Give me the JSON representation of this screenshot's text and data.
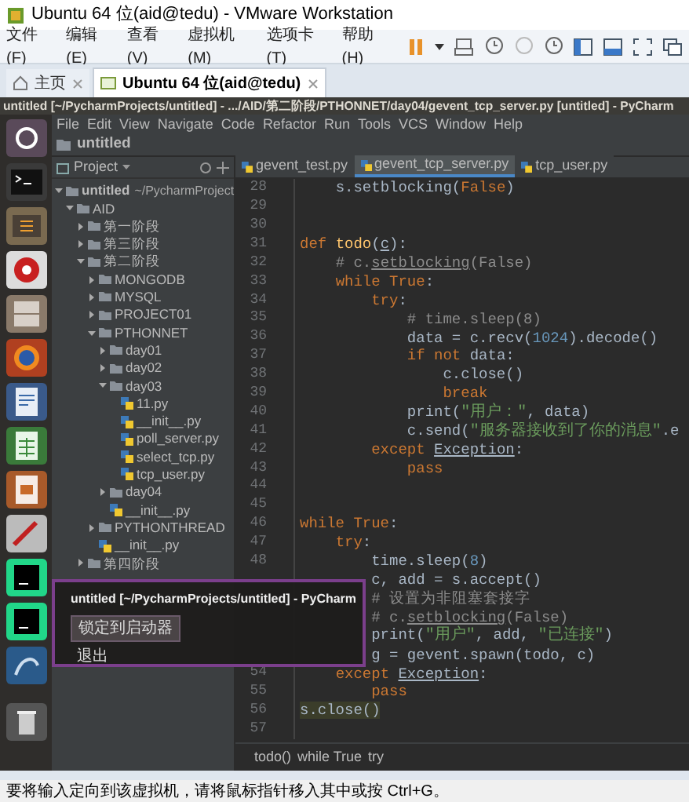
{
  "window": {
    "title": "Ubuntu 64 位(aid@tedu) - VMware Workstation"
  },
  "menu": [
    "文件(F)",
    "编辑(E)",
    "查看(V)",
    "虚拟机(M)",
    "选项卡(T)",
    "帮助(H)"
  ],
  "vm_tabs": [
    {
      "label": "主页",
      "selected": false,
      "kind": "home"
    },
    {
      "label": "Ubuntu 64 位(aid@tedu)",
      "selected": true,
      "kind": "vm"
    }
  ],
  "ubuntu_top_bar": {
    "title": "untitled [~/PycharmProjects/untitled] - .../AID/第二阶段/PTHONNET/day04/gevent_tcp_server.py [untitled] - PyCharm"
  },
  "pycharm": {
    "menu": [
      "File",
      "Edit",
      "View",
      "Navigate",
      "Code",
      "Refactor",
      "Run",
      "Tools",
      "VCS",
      "Window",
      "Help"
    ],
    "nav_bar": "untitled",
    "project_header": "Project",
    "tree": [
      {
        "label": "untitled",
        "hint": "~/PycharmProject",
        "kind": "folder",
        "expanded": true,
        "children": [
          {
            "label": "AID",
            "kind": "folder",
            "expanded": true,
            "children": [
              {
                "label": "第一阶段",
                "kind": "folder",
                "expanded": false
              },
              {
                "label": "第三阶段",
                "kind": "folder",
                "expanded": false
              },
              {
                "label": "第二阶段",
                "kind": "folder",
                "expanded": true,
                "children": [
                  {
                    "label": "MONGODB",
                    "kind": "folder",
                    "expanded": false
                  },
                  {
                    "label": "MYSQL",
                    "kind": "folder",
                    "expanded": false
                  },
                  {
                    "label": "PROJECT01",
                    "kind": "folder",
                    "expanded": false
                  },
                  {
                    "label": "PTHONNET",
                    "kind": "folder",
                    "expanded": true,
                    "children": [
                      {
                        "label": "day01",
                        "kind": "folder",
                        "expanded": false
                      },
                      {
                        "label": "day02",
                        "kind": "folder",
                        "expanded": false
                      },
                      {
                        "label": "day03",
                        "kind": "folder",
                        "expanded": true,
                        "children": [
                          {
                            "label": "11.py",
                            "kind": "file"
                          },
                          {
                            "label": "__init__.py",
                            "kind": "file"
                          },
                          {
                            "label": "poll_server.py",
                            "kind": "file"
                          },
                          {
                            "label": "select_tcp.py",
                            "kind": "file"
                          },
                          {
                            "label": "tcp_user.py",
                            "kind": "file"
                          }
                        ]
                      },
                      {
                        "label": "day04",
                        "kind": "folder",
                        "expanded": false
                      },
                      {
                        "label": "__init__.py",
                        "kind": "file"
                      }
                    ]
                  },
                  {
                    "label": "PYTHONTHREAD",
                    "kind": "folder",
                    "expanded": false
                  },
                  {
                    "label": "__init__.py",
                    "kind": "file"
                  }
                ]
              },
              {
                "label": "第四阶段",
                "kind": "folder",
                "expanded": false
              }
            ]
          }
        ]
      }
    ],
    "editor_tabs": [
      {
        "label": "gevent_test.py",
        "selected": false
      },
      {
        "label": "gevent_tcp_server.py",
        "selected": true
      },
      {
        "label": "tcp_user.py",
        "selected": false
      }
    ],
    "code": [
      {
        "n": "28",
        "segs": [
          {
            "text": "    s.setblocking(",
            "kind": "plain"
          },
          {
            "text": "False",
            "kind": "keyword"
          },
          {
            "text": ")",
            "kind": "plain"
          }
        ]
      },
      {
        "n": "29"
      },
      {
        "n": "30"
      },
      {
        "n": "31",
        "segs": [
          {
            "text": "def ",
            "kind": "keyword"
          },
          {
            "text": "todo",
            "kind": "function"
          },
          {
            "text": "(",
            "kind": "plain"
          },
          {
            "text": "c",
            "kind": "underlined"
          },
          {
            "text": "):",
            "kind": "plain"
          }
        ]
      },
      {
        "n": "32",
        "segs": [
          {
            "text": "    # c.",
            "kind": "comment"
          },
          {
            "text": "setblocking",
            "kind": "spellcheck"
          },
          {
            "text": "(False)",
            "kind": "comment"
          }
        ]
      },
      {
        "n": "33",
        "segs": [
          {
            "text": "    while True",
            "kind": "keyword"
          },
          {
            "text": ":",
            "kind": "plain"
          }
        ]
      },
      {
        "n": "34",
        "segs": [
          {
            "text": "        try",
            "kind": "keyword"
          },
          {
            "text": ":",
            "kind": "plain"
          }
        ]
      },
      {
        "n": "35",
        "segs": [
          {
            "text": "            # time.sleep(8)",
            "kind": "comment"
          }
        ]
      },
      {
        "n": "36",
        "segs": [
          {
            "text": "            data = c.recv(",
            "kind": "plain"
          },
          {
            "text": "1024",
            "kind": "number"
          },
          {
            "text": ").decode()",
            "kind": "plain"
          }
        ]
      },
      {
        "n": "37",
        "segs": [
          {
            "text": "            if not ",
            "kind": "keyword"
          },
          {
            "text": "data:",
            "kind": "plain"
          }
        ]
      },
      {
        "n": "38",
        "segs": [
          {
            "text": "                c.close()",
            "kind": "plain"
          }
        ]
      },
      {
        "n": "39",
        "segs": [
          {
            "text": "                break",
            "kind": "keyword"
          }
        ]
      },
      {
        "n": "40",
        "segs": [
          {
            "text": "            print(",
            "kind": "plain"
          },
          {
            "text": "\"用户：\"",
            "kind": "string"
          },
          {
            "text": ", data)",
            "kind": "plain"
          }
        ]
      },
      {
        "n": "41",
        "segs": [
          {
            "text": "            c.send(",
            "kind": "plain"
          },
          {
            "text": "\"服务器接收到了你的消息\"",
            "kind": "string"
          },
          {
            "text": ".e",
            "kind": "plain"
          }
        ]
      },
      {
        "n": "42",
        "segs": [
          {
            "text": "        except ",
            "kind": "keyword"
          },
          {
            "text": "Exception",
            "kind": "underlined"
          },
          {
            "text": ":",
            "kind": "plain"
          }
        ]
      },
      {
        "n": "43",
        "segs": [
          {
            "text": "            pass",
            "kind": "keyword"
          }
        ]
      },
      {
        "n": "44"
      },
      {
        "n": "45"
      },
      {
        "n": "46",
        "segs": [
          {
            "text": "while True",
            "kind": "keyword"
          },
          {
            "text": ":",
            "kind": "plain"
          }
        ]
      },
      {
        "n": "47",
        "segs": [
          {
            "text": "    try",
            "kind": "keyword"
          },
          {
            "text": ":",
            "kind": "plain"
          }
        ]
      },
      {
        "n": "48",
        "segs": [
          {
            "text": "        time.sleep(",
            "kind": "plain"
          },
          {
            "text": "8",
            "kind": "number"
          },
          {
            "text": ")",
            "kind": "plain"
          }
        ]
      },
      {
        "segs": [
          {
            "text": "        c, add = s.accept()",
            "kind": "plain"
          }
        ]
      },
      {
        "segs": [
          {
            "text": "        # 设置为非阻塞套接字",
            "kind": "comment"
          }
        ]
      },
      {
        "segs": [
          {
            "text": "        # c.",
            "kind": "comment"
          },
          {
            "text": "setblocking",
            "kind": "spellcheck"
          },
          {
            "text": "(False)",
            "kind": "comment"
          }
        ]
      },
      {
        "segs": [
          {
            "text": "        print(",
            "kind": "plain"
          },
          {
            "text": "\"用户\"",
            "kind": "string"
          },
          {
            "text": ", add, ",
            "kind": "plain"
          },
          {
            "text": "\"已连接\"",
            "kind": "string"
          },
          {
            "text": ")",
            "kind": "plain"
          }
        ]
      },
      {
        "segs": [
          {
            "text": "        g = gevent.spawn(todo, c)",
            "kind": "plain"
          }
        ]
      },
      {
        "n": "54",
        "segs": [
          {
            "text": "    except ",
            "kind": "keyword"
          },
          {
            "text": "Exception",
            "kind": "underlined"
          },
          {
            "text": ":",
            "kind": "plain"
          }
        ]
      },
      {
        "n": "55",
        "segs": [
          {
            "text": "        pass",
            "kind": "keyword"
          }
        ]
      },
      {
        "n": "56",
        "segs": [
          {
            "text": "s.close()",
            "kind": "highlight"
          }
        ]
      },
      {
        "n": "57"
      }
    ],
    "breadcrumbs": [
      "todo()",
      "while True",
      "try"
    ]
  },
  "launcher_menu": {
    "title": "untitled [~/PycharmProjects/untitled] - PyCharm",
    "items": [
      {
        "label": "锁定到启动器",
        "selected": true
      },
      {
        "label": "退出",
        "selected": false
      }
    ]
  },
  "status_bar": "要将输入定向到该虚拟机，请将鼠标指针移入其中或按 Ctrl+G。"
}
